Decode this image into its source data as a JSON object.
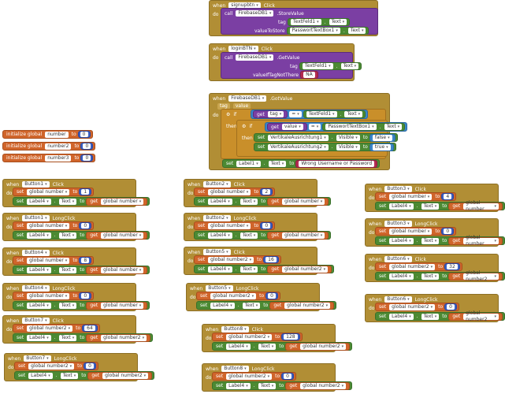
{
  "kw": {
    "when": "when",
    "do": "do",
    "call": "call",
    "set": "set",
    "get": "get",
    "to": "to",
    "if": "if",
    "then": "then",
    "initialize_global": "initialize global",
    "tag": "tag",
    "value": "value"
  },
  "top_events": {
    "signup": {
      "component": "signupbtn",
      "event": "Click",
      "db": "FirebaseDB1",
      "method": ".StoreValue",
      "tag_label": "tag",
      "tag_comp": "TextFeld1",
      "tag_prop": "Text",
      "value_label": "valueToStore",
      "value_comp": "PasswortTextBox1",
      "value_prop": "Text"
    },
    "login": {
      "component": "loginBTN",
      "event": "Click",
      "db": "FirebaseDB1",
      "method": ".GetValue",
      "tag_label": "tag",
      "tag_comp": "TextFeld1",
      "tag_prop": "Text",
      "vint_label": "valueIfTagNotThere",
      "vint_value": "NA"
    },
    "gotvalue": {
      "component": "FirebaseDB1",
      "event": ".GotValue",
      "param_tag": "tag",
      "param_value": "value",
      "cond1_var": "tag",
      "cond1_op": "=",
      "cond1_comp": "TextFeld1",
      "cond1_prop": "Text",
      "cond2_var": "value",
      "cond2_op": "=",
      "cond2_comp": "PasswortTextBox1",
      "cond2_prop": "Text",
      "then1_comp": "VertikaleAusrichtung1",
      "then1_prop": "Visible",
      "then1_val": "false",
      "then2_comp": "VertikaleAusrichtung2",
      "then2_prop": "Visible",
      "then2_val": "true",
      "else_comp": "Label1",
      "else_prop": "Text",
      "else_val": "Wrong Username or Password"
    }
  },
  "globals": [
    {
      "name": "number",
      "value": "0"
    },
    {
      "name": "number2",
      "value": "0"
    },
    {
      "name": "number3",
      "value": "0"
    }
  ],
  "buttons": [
    {
      "comp": "Button1",
      "event": "Click",
      "var": "global number",
      "val": "1",
      "label": "Label4",
      "prop": "Text",
      "getvar": "global number"
    },
    {
      "comp": "Button1",
      "event": "LongClick",
      "var": "global number",
      "val": "0",
      "label": "Label4",
      "prop": "Text",
      "getvar": "global number"
    },
    {
      "comp": "Button4",
      "event": "Click",
      "var": "global number",
      "val": "8",
      "label": "Label4",
      "prop": "Text",
      "getvar": "global number"
    },
    {
      "comp": "Button4",
      "event": "LongClick",
      "var": "global number",
      "val": "0",
      "label": "Label4",
      "prop": "Text",
      "getvar": "global number"
    },
    {
      "comp": "Button7",
      "event": "Click",
      "var": "global number2",
      "val": "64",
      "label": "Label4",
      "prop": "Text",
      "getvar": "global number2"
    },
    {
      "comp": "Button7",
      "event": "LongClick",
      "var": "global number2",
      "val": "0",
      "label": "Label4",
      "prop": "Text",
      "getvar": "global number2"
    },
    {
      "comp": "Button2",
      "event": "Click",
      "var": "global number",
      "val": "2",
      "label": "Label4",
      "prop": "Text",
      "getvar": "global number"
    },
    {
      "comp": "Button2",
      "event": "LongClick",
      "var": "global number",
      "val": "0",
      "label": "Label4",
      "prop": "Text",
      "getvar": "global number"
    },
    {
      "comp": "Button5",
      "event": "Click",
      "var": "global number2",
      "val": "16",
      "label": "Label4",
      "prop": "Text",
      "getvar": "global number2"
    },
    {
      "comp": "Button5",
      "event": "LongClick",
      "var": "global number2",
      "val": "0",
      "label": "Label4",
      "prop": "Text",
      "getvar": "global number2"
    },
    {
      "comp": "Button8",
      "event": "Click",
      "var": "global number2",
      "val": "128",
      "label": "Label4",
      "prop": "Text",
      "getvar": "global number2"
    },
    {
      "comp": "Button8",
      "event": "LongClick",
      "var": "global number2",
      "val": "0",
      "label": "Label4",
      "prop": "Text",
      "getvar": "global number2"
    },
    {
      "comp": "Button3",
      "event": "Click",
      "var": "global number",
      "val": "4",
      "label": "Label4",
      "prop": "Text",
      "getvar": "global number"
    },
    {
      "comp": "Button3",
      "event": "LongClick",
      "var": "global number",
      "val": "0",
      "label": "Label4",
      "prop": "Text",
      "getvar": "global number"
    },
    {
      "comp": "Button6",
      "event": "Click",
      "var": "global number2",
      "val": "32",
      "label": "Label4",
      "prop": "Text",
      "getvar": "global number2"
    },
    {
      "comp": "Button6",
      "event": "LongClick",
      "var": "global number2",
      "val": "0",
      "label": "Label4",
      "prop": "Text",
      "getvar": "global number2"
    }
  ],
  "colors": {
    "event": "#b18e35",
    "set": "#d0652b",
    "number": "#3b5fc0",
    "component": "#4c8a33",
    "text": "#b42b52",
    "db": "#7b3fa3",
    "logic": "#3a86c8"
  }
}
